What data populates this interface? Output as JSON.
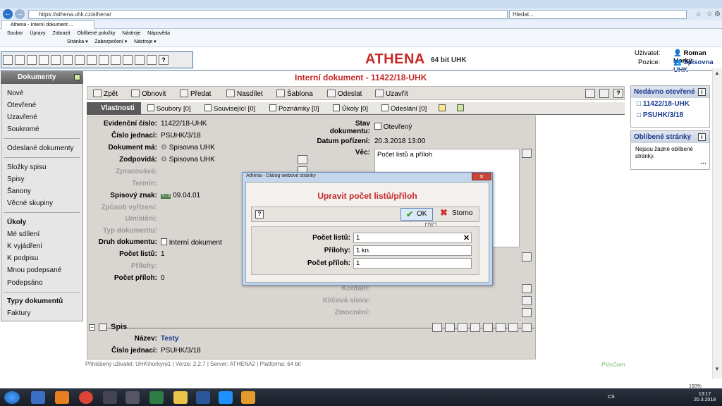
{
  "browser": {
    "url": "https://athena.uhk.cz/athena/",
    "search_placeholder": "Hledat...",
    "tab_title": "Athena - Interní dokument ...",
    "menu": [
      "Soubor",
      "Úpravy",
      "Zobrazit",
      "Oblíbené položky",
      "Nástroje",
      "Nápověda"
    ],
    "commands": [
      "Stránka ▾",
      "Zabezpečení ▾",
      "Nástroje ▾"
    ]
  },
  "app": {
    "logo": "ATHENA",
    "logo_sub": "64 bit UHK",
    "user_label": "Uživatel:",
    "user_name": "Roman Horký",
    "position_label": "Pozice:",
    "position_name": "Spisovna UHK"
  },
  "sidebar": {
    "title": "Dokumenty",
    "group1": [
      "Nové",
      "Otevřené",
      "Uzavřené",
      "Soukromé"
    ],
    "group2": [
      "Odeslané dokumenty"
    ],
    "group3": [
      "Složky spisu",
      "Spisy",
      "Šanony",
      "Věcné skupiny"
    ],
    "group4_head": "Úkoly",
    "group4": [
      "Mé sdílení",
      "K vyjádření",
      "K podpisu",
      "Mnou podepsané",
      "Podepsáno"
    ],
    "group5_head": "Typy dokumentů",
    "group5": [
      "Faktury"
    ]
  },
  "document": {
    "title": "Interní dokument - 11422/18-UHK",
    "actions": [
      "Zpět",
      "Obnovit",
      "Předat",
      "Nasdílet",
      "Šablona",
      "Odeslat",
      "Uzavřít"
    ],
    "tabs": {
      "active": "Vlastnosti",
      "others": [
        "Soubory [0]",
        "Související [0]",
        "Poznámky [0]",
        "Úkoly [0]",
        "Odeslání [0]"
      ]
    },
    "fields": {
      "evidencni_cislo_label": "Evidenční číslo:",
      "evidencni_cislo": "11422/18-UHK",
      "cislo_jednaci_label": "Číslo jednací:",
      "cislo_jednaci": "PSUHK/3/18",
      "dokument_ma_label": "Dokument má:",
      "dokument_ma": "Spisovna UHK",
      "zodpovida_label": "Zodpovídá:",
      "zodpovida": "Spisovna UHK",
      "zpracovava_label": "Zpracovává:",
      "termin_label": "Termín:",
      "spisovy_znak_label": "Spisový znak:",
      "spisovy_znak_badge": "S10",
      "spisovy_znak": "09.04.01",
      "zpusob_vyrizeni_label": "Způsob vyřízení:",
      "umisteni_label": "Umístění:",
      "typ_dokumentu_label": "Typ dokumentu:",
      "druh_dokumentu_label": "Druh dokumentu:",
      "druh_dokumentu": "Interní dokument",
      "pocet_listu_label": "Počet listů:",
      "pocet_listu": "1",
      "prilohy_label": "Přílohy:",
      "pocet_priloh_label": "Počet příloh:",
      "pocet_priloh": "0",
      "stav_label_1": "Stav",
      "stav_label_2": "dokumentu:",
      "stav": "Otevřený",
      "datum_label": "Datum pořízení:",
      "datum": "20.3.2018 13:00",
      "vec_label": "Věc:",
      "vec": "Počet listů a příloh",
      "kontakt_label": "Kontakt:",
      "klicova_slova_label": "Klíčová slova:",
      "zmocneni_label": "Zmocnění:"
    },
    "spis": {
      "heading": "Spis",
      "nazev_label": "Název:",
      "nazev": "Testy",
      "cislo_label": "Číslo jednací:",
      "cislo": "PSUHK/3/18"
    },
    "footer": "Přihlášený uživatel: UHK\\horkyro1  |  Verze: 2.2.7  |  Server: ATHENA2  |  Platforma: 64 bit",
    "brand": "PilsCom"
  },
  "right_panel": {
    "recent_title": "Nedávno otevřené",
    "recent": [
      "11422/18-UHK",
      "PSUHK/3/18"
    ],
    "fav_title": "Oblíbené stránky",
    "fav_text": "Nejsou žádné oblíbené stránky."
  },
  "dialog": {
    "window_title": "Athena - Dialog webové stránky",
    "heading": "Upravit počet listů/příloh",
    "ok": "OK",
    "storno": "Storno",
    "tooltip": "OK",
    "pocet_listu_label": "Počet listů:",
    "pocet_listu_value": "1",
    "prilohy_label": "Přílohy:",
    "prilohy_value": "1 kn.",
    "pocet_priloh_label": "Počet příloh:",
    "pocet_priloh_value": "1"
  },
  "taskbar": {
    "lang": "CS",
    "time": "13:17",
    "date": "20.3.2018",
    "zoom": "150%"
  },
  "colors": {
    "accent_red": "#c62828",
    "link_blue": "#1a3c8f",
    "form_bg": "#d9d5d0"
  }
}
